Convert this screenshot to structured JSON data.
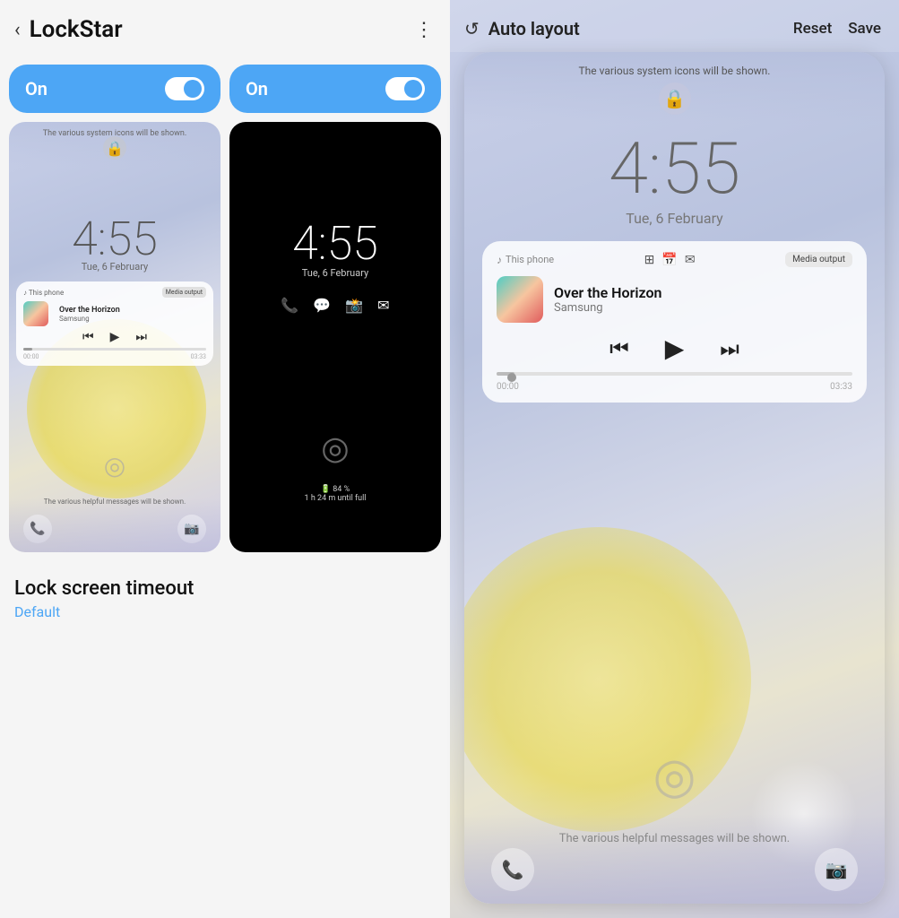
{
  "left": {
    "header": {
      "back_label": "‹",
      "title": "LockStar",
      "menu_icon": "⋮"
    },
    "toggle1": {
      "label": "On",
      "state": "on"
    },
    "toggle2": {
      "label": "On",
      "state": "on"
    },
    "preview_light": {
      "top_msg": "The various system icons will be shown.",
      "time": "4:55",
      "date": "Tue, 6 February",
      "music": {
        "source": "♪ This phone",
        "title": "Over the Horizon",
        "artist": "Samsung",
        "media_output": "Media output",
        "time_start": "00:00",
        "time_end": "03:33"
      },
      "helpful_msg": "The various helpful messages will be shown.",
      "bottom_icons": [
        "📞",
        "📷"
      ]
    },
    "preview_dark": {
      "time": "4:55",
      "date": "Tue, 6 February",
      "quick_icons": [
        "📞",
        "💬",
        "📸",
        "✉"
      ],
      "battery_pct": "🔋 84 %",
      "battery_time": "1 h 24 m until full"
    },
    "timeout": {
      "title": "Lock screen timeout",
      "value": "Default"
    }
  },
  "right": {
    "header": {
      "icon": "↺",
      "title": "Auto layout",
      "reset_label": "Reset",
      "save_label": "Save"
    },
    "preview": {
      "top_msg": "The various system icons will be shown.",
      "time": "4:55",
      "date": "Tue, 6 February",
      "music": {
        "source": "♪ This phone",
        "title": "Over the Horizon",
        "artist": "Samsung",
        "media_output": "Media output",
        "time_start": "00:00",
        "time_end": "03:33"
      },
      "helpful_msg": "The various helpful messages will be shown.",
      "bottom_icons": [
        "📞",
        "📷"
      ]
    }
  }
}
